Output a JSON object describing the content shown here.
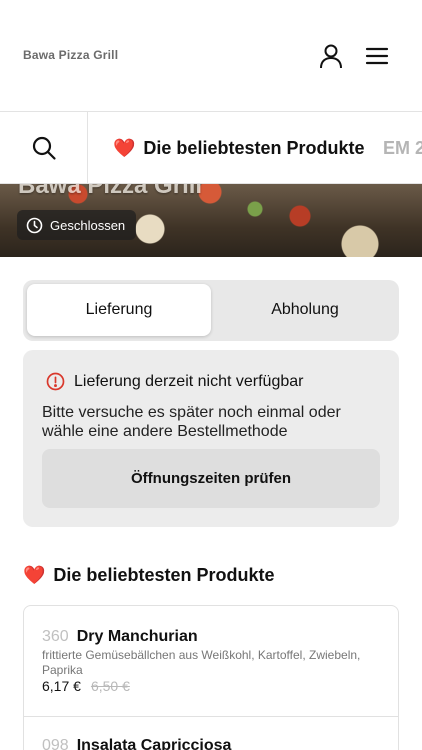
{
  "header": {
    "brand": "Bawa Pizza Grill",
    "user_icon": "user-icon",
    "menu_icon": "hamburger-menu-icon"
  },
  "category_bar": {
    "search_icon": "search-icon",
    "items": [
      {
        "emoji": "❤️",
        "label": "Die beliebtesten Produkte",
        "active": true
      },
      {
        "label": "EM 2",
        "active": false
      }
    ]
  },
  "hero": {
    "title": "Bawa Pizza Grill",
    "status": "Geschlossen",
    "status_icon": "clock-icon"
  },
  "order_mode": {
    "options": [
      "Lieferung",
      "Abholung"
    ],
    "selected": "Lieferung"
  },
  "notice": {
    "icon": "info-alert-icon",
    "title": "Lieferung derzeit nicht verfügbar",
    "message": "Bitte versuche es später noch einmal oder wähle eine andere Bestellmethode",
    "button_label": "Öffnungszeiten prüfen",
    "accent_color": "#d9382c"
  },
  "section": {
    "emoji": "❤️",
    "title": "Die beliebtesten Produkte"
  },
  "products": [
    {
      "number": "360",
      "name": "Dry Manchurian",
      "description": "frittierte Gemüsebällchen aus Weißkohl, Kartoffel, Zwiebeln, Paprika",
      "price": "6,17 €",
      "old_price": "6,50 €"
    },
    {
      "number": "098",
      "name": "Insalata Capricciosa"
    }
  ]
}
